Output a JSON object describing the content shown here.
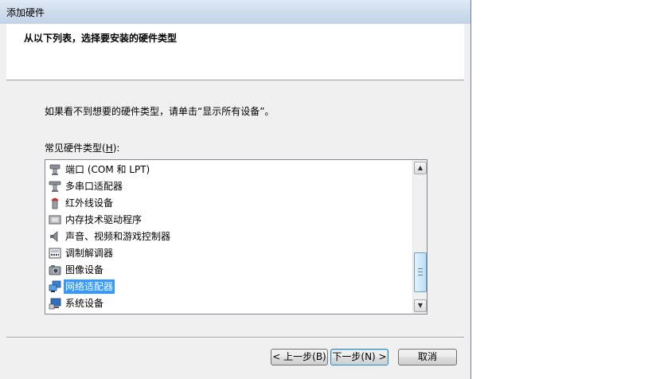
{
  "window": {
    "title": "添加硬件"
  },
  "header": {
    "heading": "从以下列表，选择要安装的硬件类型"
  },
  "instruction": "如果看不到想要的硬件类型，请单击“显示所有设备”。",
  "list": {
    "label_prefix": "常见硬件类型(",
    "label_key": "H",
    "label_suffix": "):",
    "selected_index": 7,
    "items": [
      {
        "label": "端口 (COM 和 LPT)",
        "icon": "port-icon"
      },
      {
        "label": "多串口适配器",
        "icon": "multiport-serial-icon"
      },
      {
        "label": "红外线设备",
        "icon": "infrared-icon"
      },
      {
        "label": "内存技术驱动程序",
        "icon": "memory-technology-icon"
      },
      {
        "label": "声音、视频和游戏控制器",
        "icon": "speaker-icon"
      },
      {
        "label": "调制解调器",
        "icon": "modem-icon"
      },
      {
        "label": "图像设备",
        "icon": "camera-icon"
      },
      {
        "label": "网络适配器",
        "icon": "network-adapter-icon"
      },
      {
        "label": "系统设备",
        "icon": "system-device-icon"
      }
    ]
  },
  "buttons": {
    "back": "< 上一步(B)",
    "next": "下一步(N) >",
    "cancel": "取消"
  }
}
